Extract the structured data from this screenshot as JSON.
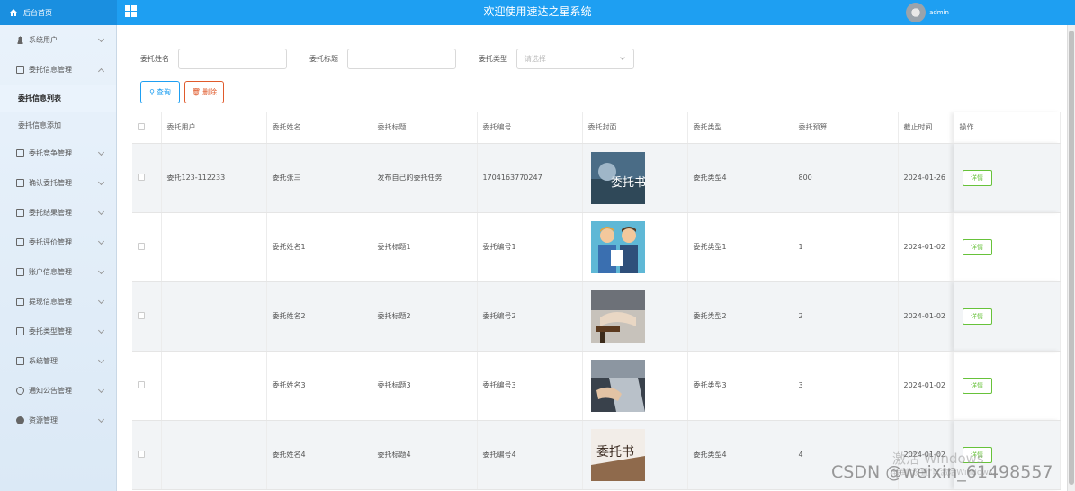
{
  "header": {
    "brand": "后台首页",
    "title": "欢迎使用速达之星系统",
    "user": "admin",
    "color": "#1e9ff2"
  },
  "sidebar": {
    "items": [
      {
        "label": "系统用户",
        "icon": "user-icon",
        "expanded": false
      },
      {
        "label": "委托信息管理",
        "icon": "doc-icon",
        "expanded": true,
        "children": [
          {
            "label": "委托信息列表",
            "active": true
          },
          {
            "label": "委托信息添加",
            "active": false
          }
        ]
      },
      {
        "label": "委托竞争管理",
        "icon": "doc-icon",
        "expanded": false
      },
      {
        "label": "确认委托管理",
        "icon": "doc-icon",
        "expanded": false
      },
      {
        "label": "委托结果管理",
        "icon": "doc-icon",
        "expanded": false
      },
      {
        "label": "委托评价管理",
        "icon": "doc-icon",
        "expanded": false
      },
      {
        "label": "账户信息管理",
        "icon": "doc-icon",
        "expanded": false
      },
      {
        "label": "提现信息管理",
        "icon": "doc-icon",
        "expanded": false
      },
      {
        "label": "委托类型管理",
        "icon": "doc-icon",
        "expanded": false
      },
      {
        "label": "系统管理",
        "icon": "image-icon",
        "expanded": false
      },
      {
        "label": "通知公告管理",
        "icon": "info-icon",
        "expanded": false
      },
      {
        "label": "资源管理",
        "icon": "location-icon",
        "expanded": false
      }
    ]
  },
  "filters": {
    "name_label": "委托姓名",
    "title_label": "委托标题",
    "type_label": "委托类型",
    "type_placeholder": "请选择"
  },
  "buttons": {
    "search": "查询",
    "delete": "删除",
    "detail": "详情"
  },
  "table": {
    "columns": [
      "委托用户",
      "委托姓名",
      "委托标题",
      "委托编号",
      "委托封面",
      "委托类型",
      "委托预算",
      "截止时间",
      "操作"
    ],
    "rows": [
      {
        "user": "委托123-112233",
        "name": "委托张三",
        "title": "发布自己的委托任务",
        "code": "1704163770247",
        "type": "委托类型4",
        "budget": "800",
        "deadline": "2024-01-26",
        "cover": "委托书"
      },
      {
        "user": "",
        "name": "委托姓名1",
        "title": "委托标题1",
        "code": "委托编号1",
        "type": "委托类型1",
        "budget": "1",
        "deadline": "2024-01-02",
        "cover": ""
      },
      {
        "user": "",
        "name": "委托姓名2",
        "title": "委托标题2",
        "code": "委托编号2",
        "type": "委托类型2",
        "budget": "2",
        "deadline": "2024-01-02",
        "cover": ""
      },
      {
        "user": "",
        "name": "委托姓名3",
        "title": "委托标题3",
        "code": "委托编号3",
        "type": "委托类型3",
        "budget": "3",
        "deadline": "2024-01-02",
        "cover": ""
      },
      {
        "user": "",
        "name": "委托姓名4",
        "title": "委托标题4",
        "code": "委托编号4",
        "type": "委托类型4",
        "budget": "4",
        "deadline": "2024-01-02",
        "cover": "委托书"
      }
    ]
  },
  "watermarks": {
    "windows": "激活 Windows",
    "windows_sub": "转到\"设置\"以激活Windows。",
    "csdn": "CSDN @weixin_61498557"
  }
}
